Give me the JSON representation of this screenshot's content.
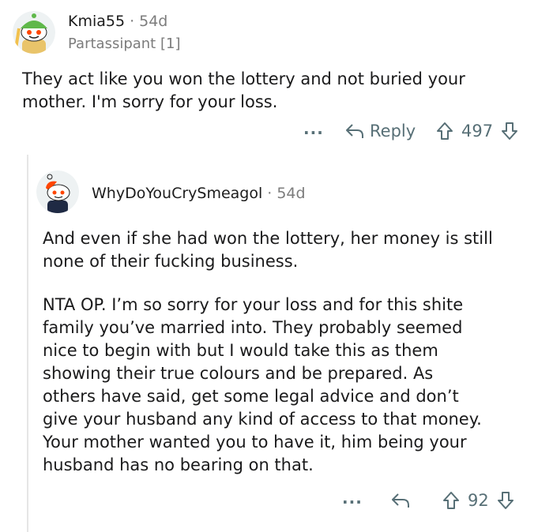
{
  "comment": {
    "username": "Kmia55",
    "separator": "·",
    "age": "54d",
    "flair": "Partassipant [1]",
    "text": "They act like you won the lottery and not buried your\nmother. I'm sorry for your loss.",
    "more_label": "···",
    "reply_label": "Reply",
    "score": "497"
  },
  "reply": {
    "username": "WhyDoYouCrySmeagol",
    "separator": "·",
    "age": "54d",
    "paragraph1": "And even if she had won the lottery, her money is still\nnone of their fucking business.",
    "paragraph2": "NTA OP. I’m so sorry for your loss and for this shite\nfamily you’ve married into. They probably seemed\nnice to begin with but I would take this as them\nshowing their true colours and be prepared. As\nothers have said, get some legal advice and don’t\ngive your husband any kind of access to that money.\nYour mother wanted you to have it, him being your\nhusband has no bearing on that.",
    "more_label": "···",
    "score": "92"
  },
  "colors": {
    "text": "#1a1a1b",
    "meta": "#7c7c7c",
    "action": "#576f76",
    "thread_line": "#e6e6e6"
  },
  "icons": [
    "snoo-avatar-green-hat",
    "snoo-avatar-red-hair",
    "reply-arrow-icon",
    "upvote-icon",
    "downvote-icon",
    "more-icon"
  ]
}
